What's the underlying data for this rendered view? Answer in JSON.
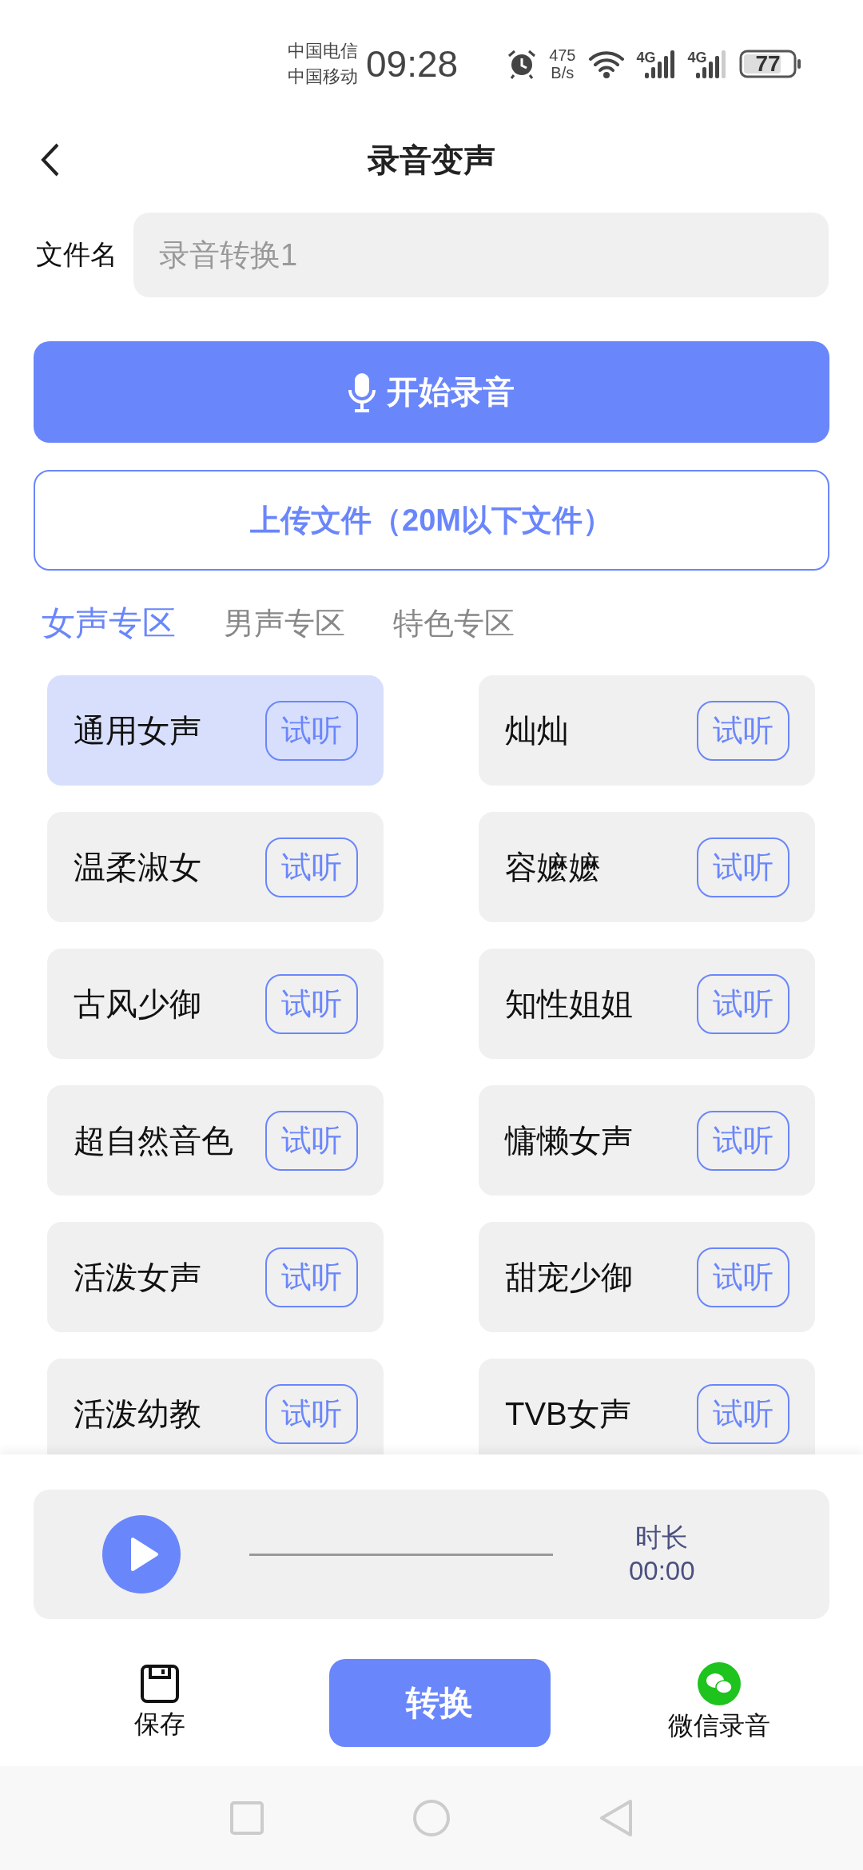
{
  "status_bar": {
    "carriers": [
      "中国电信",
      "中国移动"
    ],
    "time": "09:28",
    "net_speed": [
      "475",
      "B/s"
    ],
    "network_types": [
      "4G",
      "4G"
    ],
    "battery": "77"
  },
  "header": {
    "title": "录音变声"
  },
  "file_name": {
    "label": "文件名",
    "placeholder": "录音转换1"
  },
  "record_button": "开始录音",
  "upload_button": "上传文件（20M以下文件）",
  "tabs": [
    {
      "label": "女声专区",
      "selected": true
    },
    {
      "label": "男声专区",
      "selected": false
    },
    {
      "label": "特色专区",
      "selected": false
    }
  ],
  "voices": [
    {
      "name": "通用女声",
      "try": "试听",
      "selected": true
    },
    {
      "name": "灿灿",
      "try": "试听",
      "selected": false
    },
    {
      "name": "温柔淑女",
      "try": "试听",
      "selected": false
    },
    {
      "name": "容嬷嬷",
      "try": "试听",
      "selected": false
    },
    {
      "name": "古风少御",
      "try": "试听",
      "selected": false
    },
    {
      "name": "知性姐姐",
      "try": "试听",
      "selected": false
    },
    {
      "name": "超自然音色",
      "try": "试听",
      "selected": false
    },
    {
      "name": "慵懒女声",
      "try": "试听",
      "selected": false
    },
    {
      "name": "活泼女声",
      "try": "试听",
      "selected": false
    },
    {
      "name": "甜宠少御",
      "try": "试听",
      "selected": false
    },
    {
      "name": "活泼幼教",
      "try": "试听",
      "selected": false
    },
    {
      "name": "TVB女声",
      "try": "试听",
      "selected": false
    }
  ],
  "player": {
    "duration_label": "时长",
    "duration": "00:00"
  },
  "actions": {
    "save": "保存",
    "convert": "转换",
    "wechat": "微信录音"
  }
}
